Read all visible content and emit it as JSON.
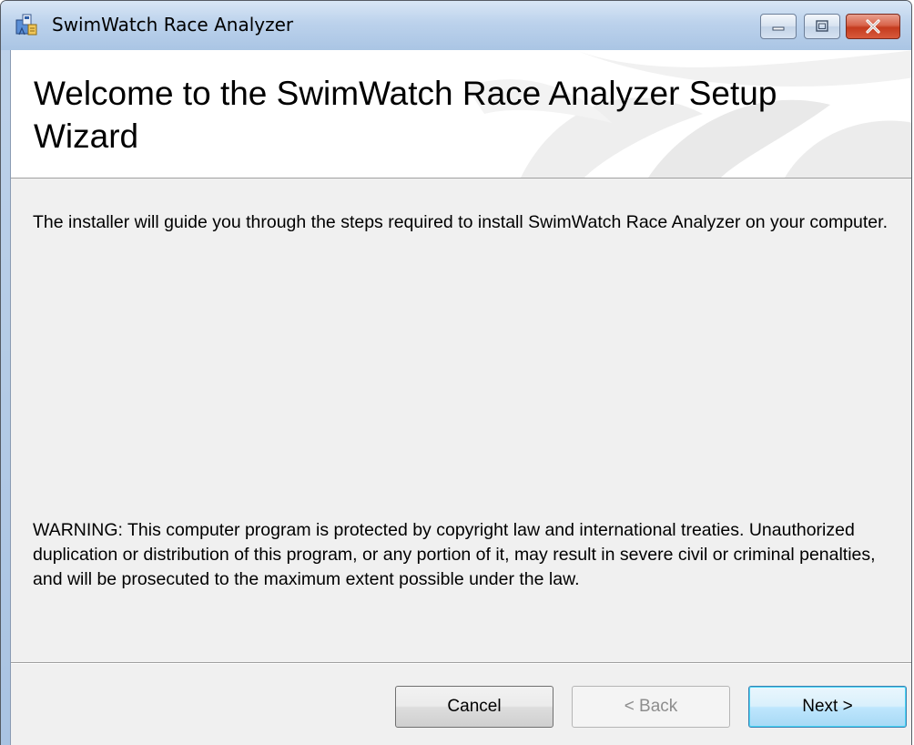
{
  "window": {
    "title": "SwimWatch Race Analyzer",
    "icon": "installer-icon",
    "caption_buttons": [
      "minimize-icon",
      "maximize-icon",
      "close-icon"
    ]
  },
  "banner": {
    "title": "Welcome to the SwimWatch Race Analyzer Setup Wizard"
  },
  "content": {
    "intro": "The installer will guide you through the steps required to install SwimWatch Race Analyzer on your computer.",
    "warning": "WARNING: This computer program is protected by copyright law and international treaties. Unauthorized duplication or distribution of this program, or any portion of it, may result in severe civil or criminal penalties, and will be prosecuted to the maximum extent possible under the law."
  },
  "buttons": {
    "cancel": "Cancel",
    "back": "< Back",
    "next": "Next >"
  },
  "colors": {
    "titlebar": "#bcd2ec",
    "close_button": "#c43b1e",
    "dialog_background": "#f0f0f0",
    "default_button_border": "#3c7fb1"
  }
}
